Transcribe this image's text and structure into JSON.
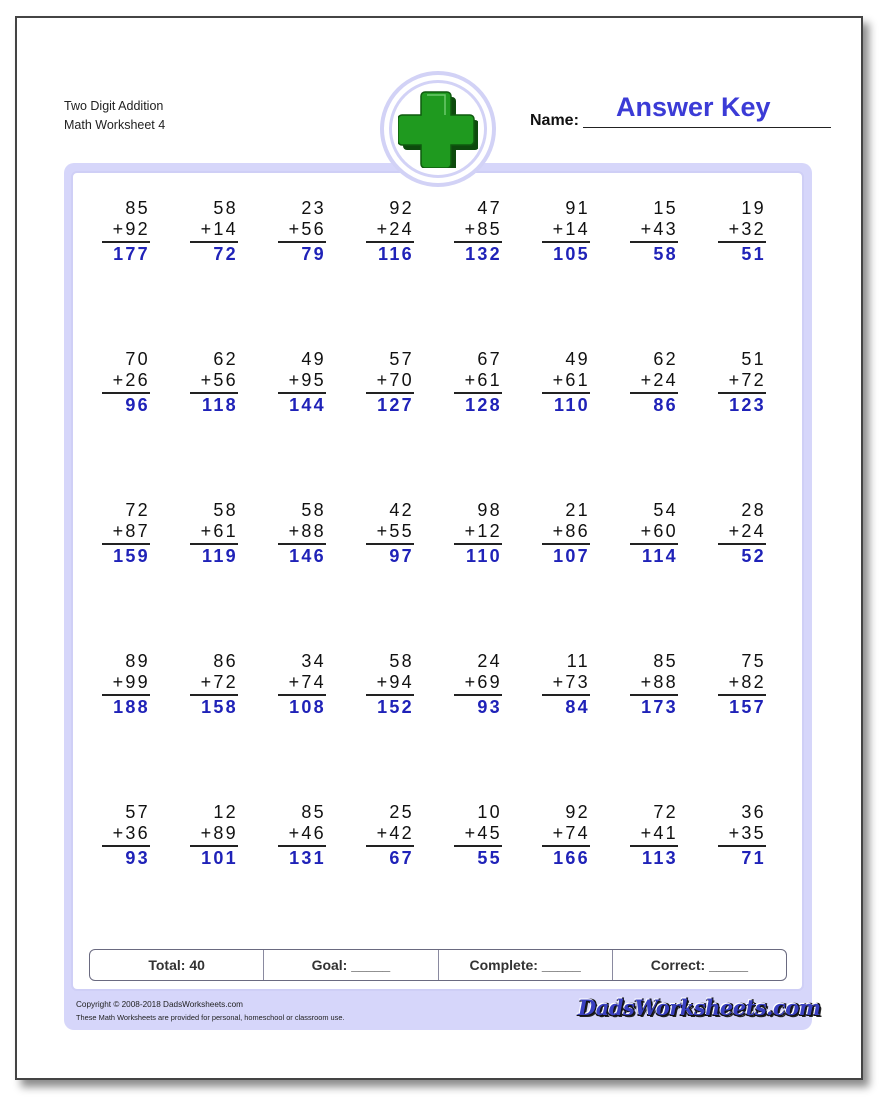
{
  "header": {
    "title_line1": "Two Digit Addition",
    "title_line2": "Math Worksheet 4",
    "name_label": "Name:",
    "name_value": "Answer Key",
    "logo_icon": "plus-icon"
  },
  "colors": {
    "accent_frame": "#d6d6fa",
    "answer_blue": "#1f22b8",
    "answer_key_blue": "#3b3bd6",
    "plus_green": "#1f9a1f"
  },
  "problems": [
    {
      "top": "85",
      "bottom": "+92",
      "answer": "177"
    },
    {
      "top": "58",
      "bottom": "+14",
      "answer": "72"
    },
    {
      "top": "23",
      "bottom": "+56",
      "answer": "79"
    },
    {
      "top": "92",
      "bottom": "+24",
      "answer": "116"
    },
    {
      "top": "47",
      "bottom": "+85",
      "answer": "132"
    },
    {
      "top": "91",
      "bottom": "+14",
      "answer": "105"
    },
    {
      "top": "15",
      "bottom": "+43",
      "answer": "58"
    },
    {
      "top": "19",
      "bottom": "+32",
      "answer": "51"
    },
    {
      "top": "70",
      "bottom": "+26",
      "answer": "96"
    },
    {
      "top": "62",
      "bottom": "+56",
      "answer": "118"
    },
    {
      "top": "49",
      "bottom": "+95",
      "answer": "144"
    },
    {
      "top": "57",
      "bottom": "+70",
      "answer": "127"
    },
    {
      "top": "67",
      "bottom": "+61",
      "answer": "128"
    },
    {
      "top": "49",
      "bottom": "+61",
      "answer": "110"
    },
    {
      "top": "62",
      "bottom": "+24",
      "answer": "86"
    },
    {
      "top": "51",
      "bottom": "+72",
      "answer": "123"
    },
    {
      "top": "72",
      "bottom": "+87",
      "answer": "159"
    },
    {
      "top": "58",
      "bottom": "+61",
      "answer": "119"
    },
    {
      "top": "58",
      "bottom": "+88",
      "answer": "146"
    },
    {
      "top": "42",
      "bottom": "+55",
      "answer": "97"
    },
    {
      "top": "98",
      "bottom": "+12",
      "answer": "110"
    },
    {
      "top": "21",
      "bottom": "+86",
      "answer": "107"
    },
    {
      "top": "54",
      "bottom": "+60",
      "answer": "114"
    },
    {
      "top": "28",
      "bottom": "+24",
      "answer": "52"
    },
    {
      "top": "89",
      "bottom": "+99",
      "answer": "188"
    },
    {
      "top": "86",
      "bottom": "+72",
      "answer": "158"
    },
    {
      "top": "34",
      "bottom": "+74",
      "answer": "108"
    },
    {
      "top": "58",
      "bottom": "+94",
      "answer": "152"
    },
    {
      "top": "24",
      "bottom": "+69",
      "answer": "93"
    },
    {
      "top": "11",
      "bottom": "+73",
      "answer": "84"
    },
    {
      "top": "85",
      "bottom": "+88",
      "answer": "173"
    },
    {
      "top": "75",
      "bottom": "+82",
      "answer": "157"
    },
    {
      "top": "57",
      "bottom": "+36",
      "answer": "93"
    },
    {
      "top": "12",
      "bottom": "+89",
      "answer": "101"
    },
    {
      "top": "85",
      "bottom": "+46",
      "answer": "131"
    },
    {
      "top": "25",
      "bottom": "+42",
      "answer": "67"
    },
    {
      "top": "10",
      "bottom": "+45",
      "answer": "55"
    },
    {
      "top": "92",
      "bottom": "+74",
      "answer": "166"
    },
    {
      "top": "72",
      "bottom": "+41",
      "answer": "113"
    },
    {
      "top": "36",
      "bottom": "+35",
      "answer": "71"
    }
  ],
  "score": {
    "total": "Total: 40",
    "goal": "Goal: _____",
    "complete": "Complete: _____",
    "correct": "Correct: _____"
  },
  "footer": {
    "copyright": "Copyright © 2008-2018 DadsWorksheets.com",
    "usage": "These Math Worksheets are provided for personal, homeschool or classroom use.",
    "brand": "DadsWorksheets.com"
  }
}
